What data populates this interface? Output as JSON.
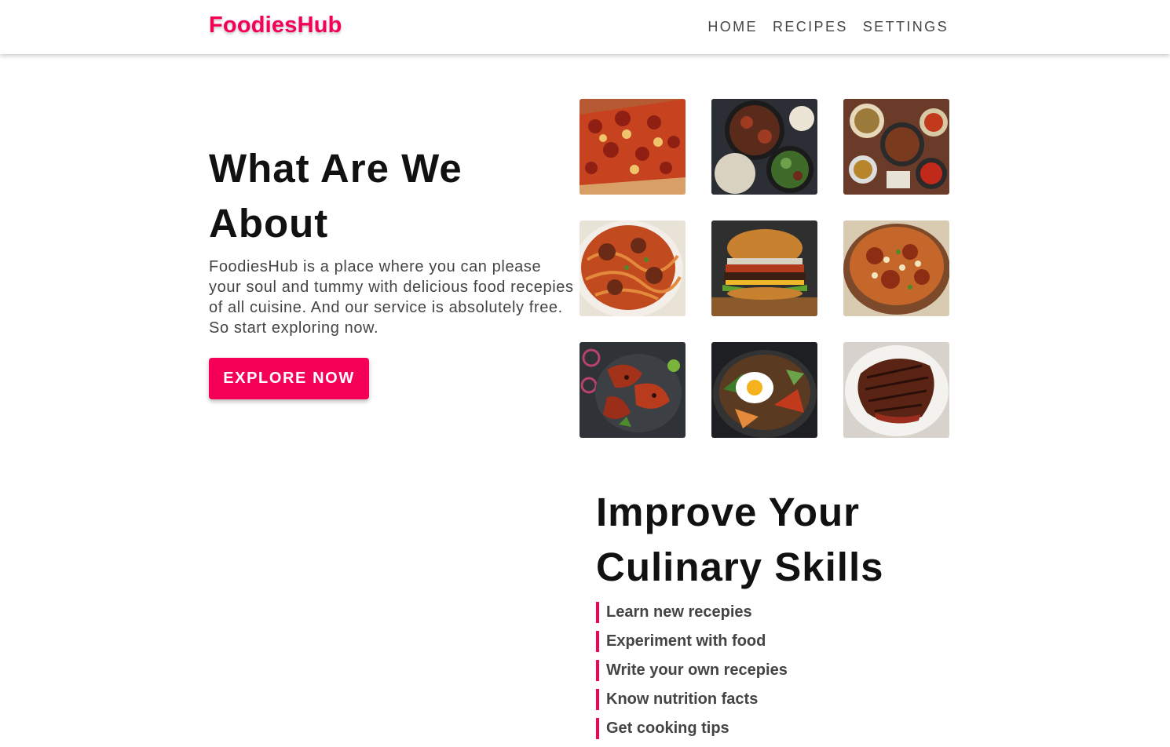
{
  "brand": {
    "logo_part1": "Foo",
    "logo_part2": "dies",
    "logo_part3": "Hub",
    "accent_color": "#f50057"
  },
  "nav": {
    "links": [
      "HOME",
      "RECIPES",
      "SETTINGS"
    ]
  },
  "about": {
    "title": "What Are We About",
    "text": "FoodiesHub is a place where you can please your soul and tummy with delicious food recepies of all cuisine. And our service is absolutely free. So start exploring now.",
    "cta_label": "EXPLORE NOW"
  },
  "gallery": {
    "images": [
      "pizza-image",
      "rice-bowl-image",
      "asian-spread-image",
      "spaghetti-meatballs-image",
      "burger-image",
      "biryani-image",
      "tandoori-chicken-image",
      "bibimbap-image",
      "steak-image"
    ]
  },
  "skills": {
    "title": "Improve Your Culinary Skills",
    "items": [
      "Learn new recepies",
      "Experiment with food",
      "Write your own recepies",
      "Know nutrition facts",
      "Get cooking tips"
    ]
  }
}
